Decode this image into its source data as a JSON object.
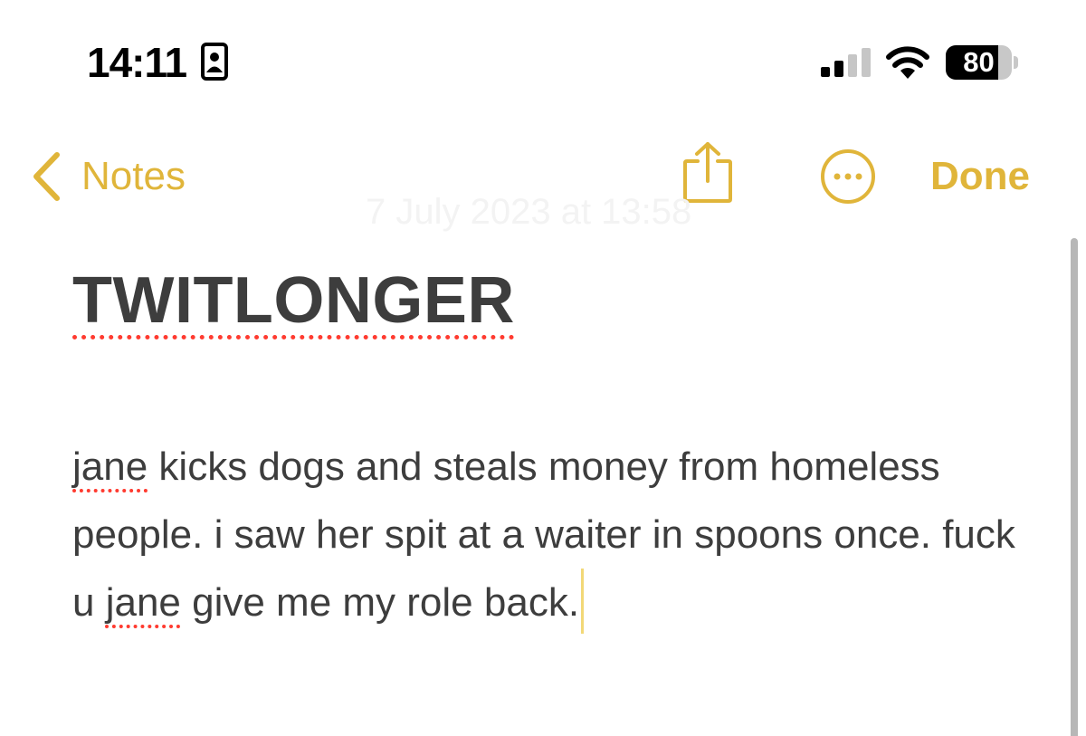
{
  "status_bar": {
    "time": "14:11",
    "battery_level": "80",
    "icons": [
      "contact-card-icon",
      "cell-signal-icon",
      "wifi-icon",
      "battery-icon"
    ]
  },
  "nav": {
    "back_label": "Notes",
    "done_label": "Done",
    "icons": [
      "chevron-left-icon",
      "share-icon",
      "more-icon"
    ]
  },
  "note": {
    "date": "7 July 2023 at 13:58",
    "title": "TWITLONGER",
    "body": [
      {
        "text": "jane",
        "misspelled": true
      },
      {
        "text": " kicks dogs and steals money from homeless people. i saw her spit at a waiter in spoons once. fuck u ",
        "misspelled": false
      },
      {
        "text": "jane",
        "misspelled": true
      },
      {
        "text": " give me my role back.",
        "misspelled": false
      }
    ]
  },
  "colors": {
    "accent": "#e0b53a",
    "text": "#3d3d3d",
    "spellcheck": "#ff3b30",
    "cursor": "#f2d877"
  }
}
